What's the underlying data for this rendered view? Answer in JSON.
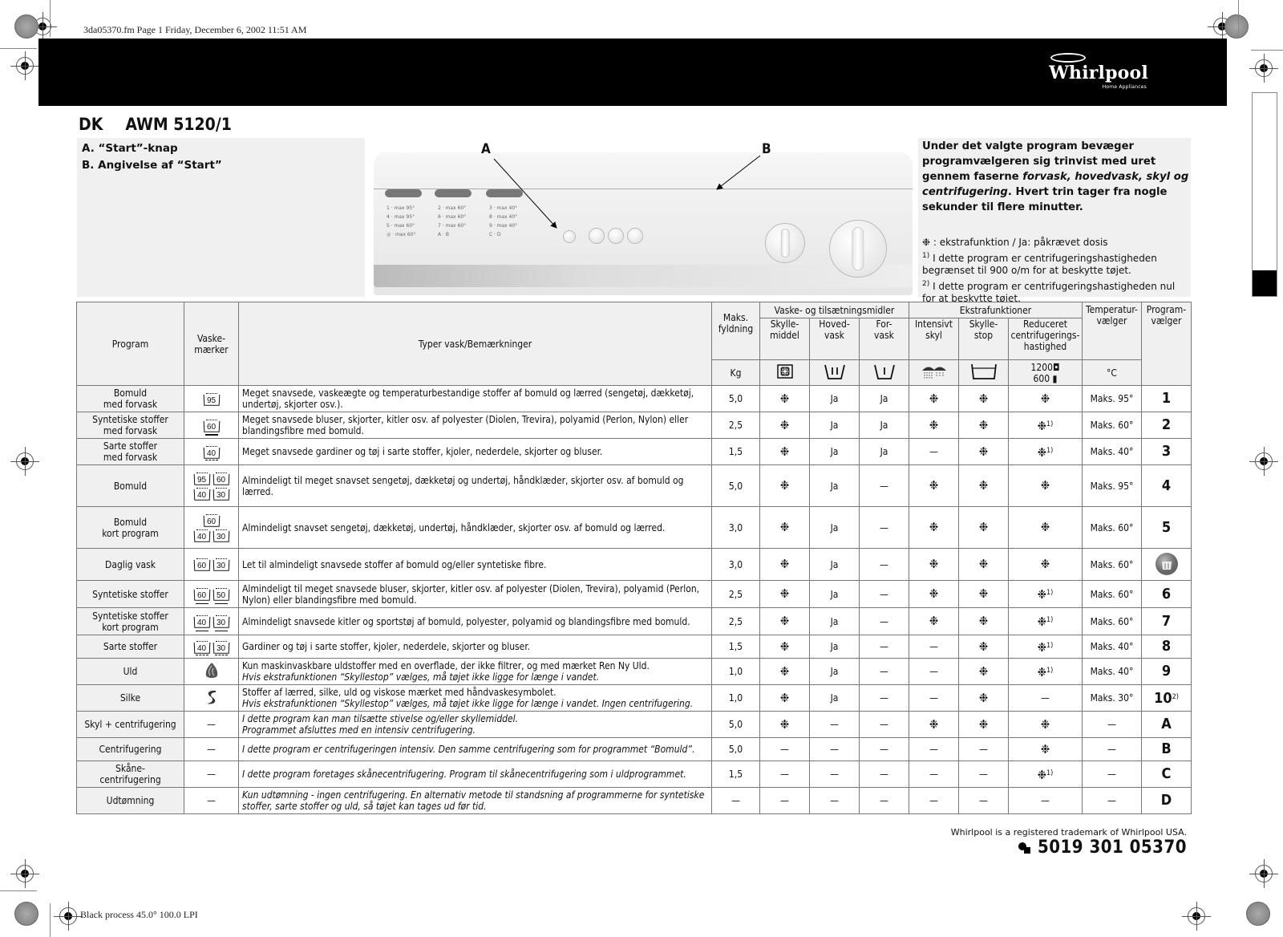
{
  "print_meta": {
    "top": "3da05370.fm  Page 1  Friday, December 6, 2002  11:51 AM",
    "bottom": "Black process 45.0° 100.0 LPI"
  },
  "brand": {
    "name": "Whirlpool",
    "sub": "Home Appliances"
  },
  "header": {
    "country": "DK",
    "model": "AWM 5120/1"
  },
  "legend": {
    "a": "A. “Start”-knap",
    "b": "B. Angivelse af “Start”"
  },
  "callouts": {
    "a": "A",
    "b": "B"
  },
  "info": {
    "lead_1": "Under det valgte program bevæger programvælgeren sig trinvist med uret gennem faserne ",
    "lead_italic": "forvask, hovedvask, skyl og centrifugering",
    "lead_2": ". Hvert trin tager fra nogle sekunder til flere minutter.",
    "symbol_note": "❉ : ekstrafunktion / Ja: påkrævet dosis",
    "note1_mark": "1)",
    "note1": "I dette program er centrifugeringshastigheden begrænset til 900 o/m for at beskytte tøjet.",
    "note2_mark": "2)",
    "note2": "I dette program er centrifugeringshastigheden nul for at beskytte tøjet."
  },
  "table": {
    "headers": {
      "program": "Program",
      "symbols": "Vaske-\nmærker",
      "description": "Typer vask/Bemærkninger",
      "load": "Maks.\nfyldning",
      "load_unit": "Kg",
      "detergents_group": "Vaske- og tilsætningsmidler",
      "softener": "Skylle-\nmiddel",
      "main_wash": "Hoved-\nvask",
      "prewash": "For-\nvask",
      "extras_group": "Ekstrafunktioner",
      "intensive_rinse": "Intensivt\nskyl",
      "rinse_hold": "Skylle-\nstop",
      "reduced_spin": "Reduceret\ncentrifugerings-\nhastighed",
      "spin_values": [
        "1200",
        "600"
      ],
      "temp": "Temperatur-\nvælger",
      "temp_unit": "°C",
      "selector": "Program-\nvælger"
    },
    "rows": [
      {
        "program": "Bomuld\nmed forvask",
        "symbols": [
          [
            "95"
          ]
        ],
        "desc": "Meget snavsede, vaskeægte og temperaturbestandige stoffer af bomuld og lærred (sengetøj, dækketøj, undertøj, skjorter osv.).",
        "desc_italic": "",
        "load": "5,0",
        "softener": "❉",
        "main": "Ja",
        "pre": "Ja",
        "intensive": "❉",
        "rinse_hold": "❉",
        "reduced": "❉",
        "reduced_note": "",
        "temp": "Maks. 95°",
        "selector": "1",
        "selector_note": ""
      },
      {
        "program": "Syntetiske stoffer\nmed forvask",
        "symbols": [
          [
            "60:1"
          ]
        ],
        "desc": "Meget snavsede bluser, skjorter, kitler osv. af polyester (Diolen, Trevira), polyamid (Perlon, Nylon) eller blandingsfibre med bomuld.",
        "desc_italic": "",
        "load": "2,5",
        "softener": "❉",
        "main": "Ja",
        "pre": "Ja",
        "intensive": "❉",
        "rinse_hold": "❉",
        "reduced": "❉",
        "reduced_note": "1)",
        "temp": "Maks. 60°",
        "selector": "2",
        "selector_note": ""
      },
      {
        "program": "Sarte stoffer\nmed forvask",
        "symbols": [
          [
            "40:2"
          ]
        ],
        "desc": "Meget snavsede gardiner og tøj i sarte stoffer, kjoler, nederdele, skjorter og bluser.",
        "desc_italic": "",
        "load": "1,5",
        "softener": "❉",
        "main": "Ja",
        "pre": "Ja",
        "intensive": "—",
        "rinse_hold": "❉",
        "reduced": "❉",
        "reduced_note": "1)",
        "temp": "Maks. 40°",
        "selector": "3",
        "selector_note": ""
      },
      {
        "program": "Bomuld",
        "symbols": [
          [
            "95",
            "60"
          ],
          [
            "40",
            "30"
          ]
        ],
        "desc": "Almindeligt til meget snavset sengetøj, dækketøj og undertøj, håndklæder, skjorter osv. af bomuld og lærred.",
        "desc_italic": "",
        "load": "5,0",
        "softener": "❉",
        "main": "Ja",
        "pre": "—",
        "intensive": "❉",
        "rinse_hold": "❉",
        "reduced": "❉",
        "reduced_note": "",
        "temp": "Maks. 95°",
        "selector": "4",
        "selector_note": ""
      },
      {
        "program": "Bomuld\nkort program",
        "symbols": [
          [
            "60"
          ],
          [
            "40",
            "30"
          ]
        ],
        "desc": "Almindeligt snavset sengetøj, dækketøj, undertøj, håndklæder, skjorter osv. af bomuld og lærred.",
        "desc_italic": "",
        "load": "3,0",
        "softener": "❉",
        "main": "Ja",
        "pre": "—",
        "intensive": "❉",
        "rinse_hold": "❉",
        "reduced": "❉",
        "reduced_note": "",
        "temp": "Maks. 60°",
        "selector": "5",
        "selector_note": ""
      },
      {
        "program": "Daglig vask",
        "symbols": [
          [
            "60",
            "30"
          ]
        ],
        "desc": "Let til almindeligt snavsede stoffer af bomuld og/eller syntetiske fibre.",
        "desc_italic": "",
        "load": "3,0",
        "softener": "❉",
        "main": "Ja",
        "pre": "—",
        "intensive": "❉",
        "rinse_hold": "❉",
        "reduced": "❉",
        "reduced_note": "",
        "temp": "Maks. 60°",
        "selector": "daily-wash-icon",
        "selector_note": ""
      },
      {
        "program": "Syntetiske stoffer",
        "symbols": [
          [
            "60:1",
            "50:1"
          ]
        ],
        "desc": "Almindeligt til meget snavsede bluser, skjorter, kitler osv. af polyester (Diolen, Trevira), polyamid (Perlon, Nylon) eller blandingsfibre med bomuld.",
        "desc_italic": "",
        "load": "2,5",
        "softener": "❉",
        "main": "Ja",
        "pre": "—",
        "intensive": "❉",
        "rinse_hold": "❉",
        "reduced": "❉",
        "reduced_note": "1)",
        "temp": "Maks. 60°",
        "selector": "6",
        "selector_note": ""
      },
      {
        "program": "Syntetiske stoffer\nkort program",
        "symbols": [
          [
            "40:1",
            "30:1"
          ]
        ],
        "desc": "Almindeligt snavsede kitler og sportstøj af bomuld, polyester, polyamid og blandingsfibre med bomuld.",
        "desc_italic": "",
        "load": "2,5",
        "softener": "❉",
        "main": "Ja",
        "pre": "—",
        "intensive": "❉",
        "rinse_hold": "❉",
        "reduced": "❉",
        "reduced_note": "1)",
        "temp": "Maks. 60°",
        "selector": "7",
        "selector_note": ""
      },
      {
        "program": "Sarte stoffer",
        "symbols": [
          [
            "40:2",
            "30:2"
          ]
        ],
        "desc": "Gardiner og tøj i sarte stoffer, kjoler, nederdele, skjorter og bluser.",
        "desc_italic": "",
        "load": "1,5",
        "softener": "❉",
        "main": "Ja",
        "pre": "—",
        "intensive": "—",
        "rinse_hold": "❉",
        "reduced": "❉",
        "reduced_note": "1)",
        "temp": "Maks. 40°",
        "selector": "8",
        "selector_note": ""
      },
      {
        "program": "Uld",
        "symbols": [
          [
            "wool"
          ]
        ],
        "desc": "Kun maskinvaskbare uldstoffer med en overflade, der ikke filtrer, og med mærket Ren Ny Uld.",
        "desc_italic": "Hvis ekstrafunktionen “Skyllestop” vælges, må tøjet ikke ligge for længe i vandet.",
        "load": "1,0",
        "softener": "❉",
        "main": "Ja",
        "pre": "—",
        "intensive": "—",
        "rinse_hold": "❉",
        "reduced": "❉",
        "reduced_note": "1)",
        "temp": "Maks. 40°",
        "selector": "9",
        "selector_note": ""
      },
      {
        "program": "Silke",
        "symbols": [
          [
            "silk"
          ]
        ],
        "desc": "Stoffer af lærred, silke, uld og viskose mærket med håndvaskesymbolet.",
        "desc_italic": "Hvis ekstrafunktionen “Skyllestop” vælges, må tøjet ikke ligge for længe i vandet. Ingen centrifugering.",
        "load": "1,0",
        "softener": "❉",
        "main": "Ja",
        "pre": "—",
        "intensive": "—",
        "rinse_hold": "❉",
        "reduced": "—",
        "reduced_note": "",
        "temp": "Maks. 30°",
        "selector": "10",
        "selector_note": "2)"
      },
      {
        "program": "Skyl + centrifugering",
        "symbols": [
          [
            "—"
          ]
        ],
        "desc": "",
        "desc_italic": "I dette program kan man tilsætte stivelse og/eller skyllemiddel.\nProgrammet afsluttes med en intensiv centrifugering.",
        "load": "5,0",
        "softener": "❉",
        "main": "—",
        "pre": "—",
        "intensive": "❉",
        "rinse_hold": "❉",
        "reduced": "❉",
        "reduced_note": "",
        "temp": "—",
        "selector": "A",
        "selector_note": ""
      },
      {
        "program": "Centrifugering",
        "symbols": [
          [
            "—"
          ]
        ],
        "desc": "",
        "desc_italic": "I dette program er centrifugeringen intensiv. Den samme centrifugering som for programmet “Bomuld”.",
        "load": "5,0",
        "softener": "—",
        "main": "—",
        "pre": "—",
        "intensive": "—",
        "rinse_hold": "—",
        "reduced": "❉",
        "reduced_note": "",
        "temp": "—",
        "selector": "B",
        "selector_note": ""
      },
      {
        "program": "Skåne-\ncentrifugering",
        "symbols": [
          [
            "—"
          ]
        ],
        "desc": "",
        "desc_italic": "I dette program foretages skånecentrifugering. Program til skånecentrifugering som i uldprogrammet.",
        "load": "1,5",
        "softener": "—",
        "main": "—",
        "pre": "—",
        "intensive": "—",
        "rinse_hold": "—",
        "reduced": "❉",
        "reduced_note": "1)",
        "temp": "—",
        "selector": "C",
        "selector_note": ""
      },
      {
        "program": "Udtømning",
        "symbols": [
          [
            "—"
          ]
        ],
        "desc": "",
        "desc_italic": "Kun udtømning - ingen centrifugering. En alternativ metode til standsning af programmerne for syntetiske stoffer, sarte stoffer og uld, så tøjet kan tages ud før tid.",
        "load": "—",
        "softener": "—",
        "main": "—",
        "pre": "—",
        "intensive": "—",
        "rinse_hold": "—",
        "reduced": "—",
        "reduced_note": "",
        "temp": "—",
        "selector": "D",
        "selector_note": ""
      }
    ]
  },
  "footer": {
    "trademark": "Whirlpool is a registered trademark of Whirlpool USA.",
    "code": "5019 301 05370"
  }
}
